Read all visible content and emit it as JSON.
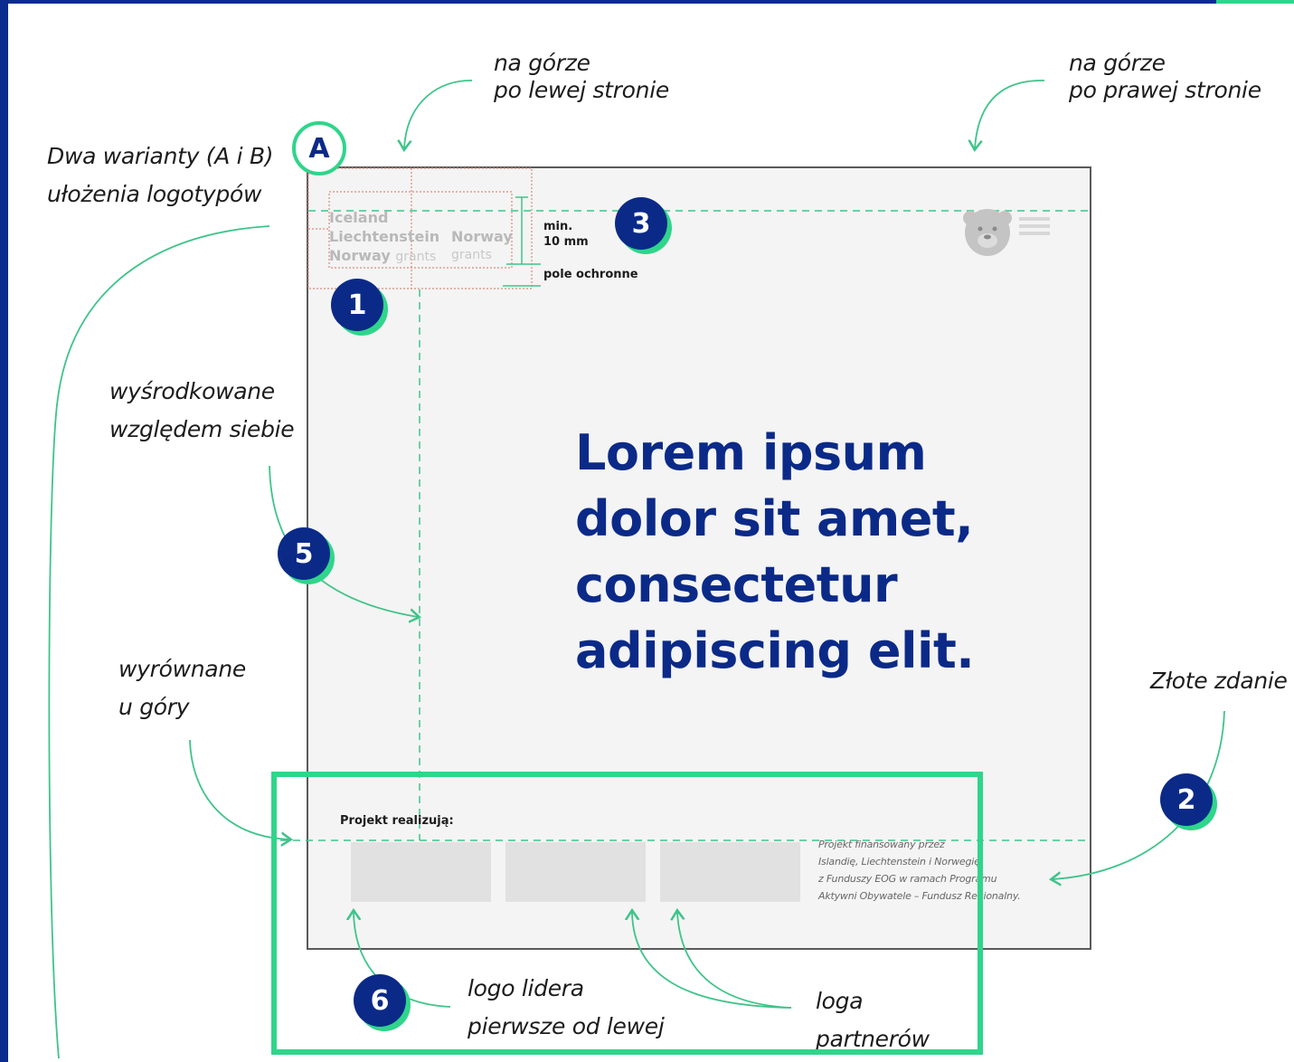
{
  "colors": {
    "navy": "#0b2a88",
    "green": "#2fd58a",
    "poster_bg": "#f4f4f4",
    "frame": "#0a2c8f"
  },
  "annotations": {
    "top_left_placement": [
      "na górze",
      "po lewej stronie"
    ],
    "top_right_placement": [
      "na górze",
      "po prawej stronie"
    ],
    "variants": [
      "Dwa warianty (A i B)",
      "ułożenia logotypów"
    ],
    "centered": [
      "wyśrodkowane",
      "względem siebie"
    ],
    "top_aligned": [
      "wyrównane",
      "u góry"
    ],
    "golden_sentence": "Złote zdanie",
    "leader_logo": [
      "logo lidera",
      "pierwsze od lewej"
    ],
    "partner_logos": [
      "loga",
      "partnerów"
    ]
  },
  "badges": {
    "variant": "A",
    "b1": "1",
    "b2": "2",
    "b3": "3",
    "b5": "5",
    "b6": "6"
  },
  "poster": {
    "headline": [
      "Lorem ipsum",
      "dolor sit amet,",
      "consectetur",
      "adipiscing elit."
    ],
    "min_label": "min.",
    "min_value": "10 mm",
    "safe_zone": "pole ochronne",
    "implementers": "Projekt realizują:",
    "funding_text": [
      "Projekt finansowany przez",
      "Islandię, Liechtenstein i Norwegię",
      "z Funduszy EOG w ramach Programu",
      "Aktywni Obywatele – Fundusz Regionalny."
    ],
    "logo_eea": [
      "Iceland",
      "Liechtenstein",
      "Norway"
    ],
    "logo_eea_sub": "grants",
    "logo_norway": "Norway",
    "logo_norway_sub": "grants"
  }
}
